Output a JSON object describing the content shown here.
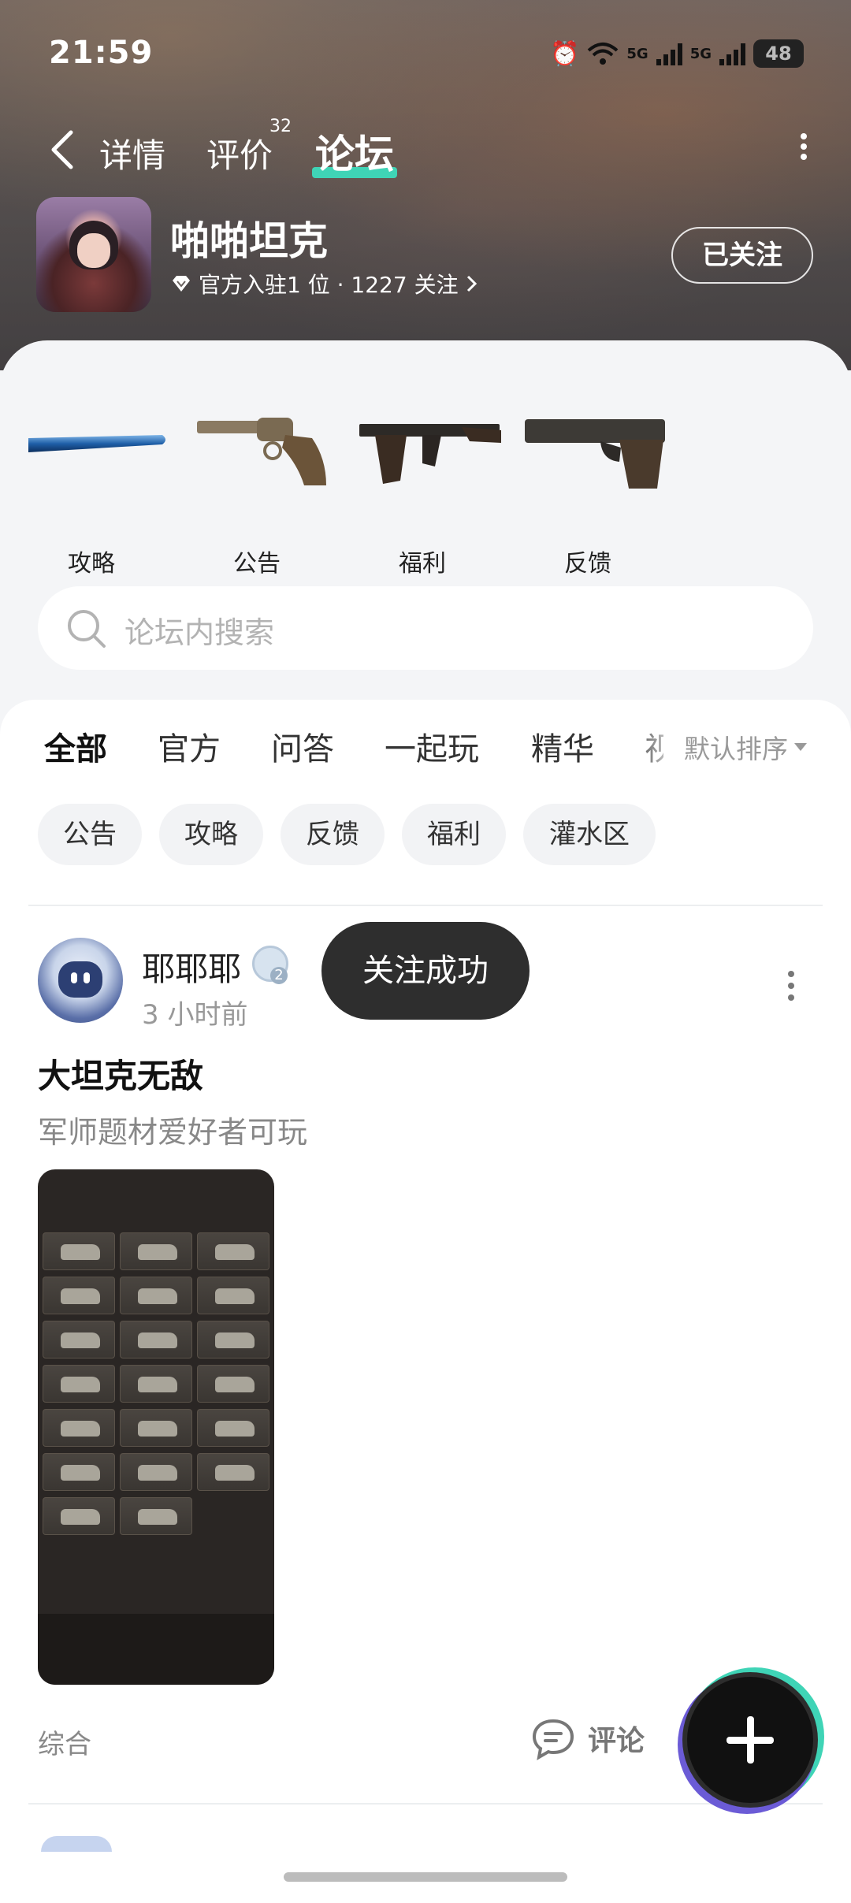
{
  "status_bar": {
    "time": "21:59",
    "network_1": "5G",
    "network_2": "5G",
    "battery": "48",
    "icons": [
      "alarm-icon",
      "wifi-icon",
      "signal-icon",
      "battery-icon"
    ]
  },
  "nav": {
    "tabs": [
      {
        "label": "详情",
        "active": false
      },
      {
        "label": "评价",
        "active": false,
        "badge": "32"
      },
      {
        "label": "论坛",
        "active": true
      }
    ]
  },
  "game": {
    "name": "啪啪坦克",
    "meta": "官方入驻1 位 · 1227 关注",
    "follow_label": "已关注"
  },
  "categories": [
    {
      "label": "攻略",
      "icon": "baseball-bat-icon"
    },
    {
      "label": "公告",
      "icon": "revolver-icon"
    },
    {
      "label": "福利",
      "icon": "rifle-icon"
    },
    {
      "label": "反馈",
      "icon": "pistol-icon"
    }
  ],
  "search": {
    "placeholder": "论坛内搜索"
  },
  "feed": {
    "tabs": [
      "全部",
      "官方",
      "问答",
      "一起玩",
      "精华",
      "视"
    ],
    "sort_label": "默认排序",
    "chips": [
      "公告",
      "攻略",
      "反馈",
      "福利",
      "灌水区"
    ]
  },
  "post": {
    "author": "耶耶耶",
    "level": "2",
    "time": "3 小时前",
    "title": "大坦克无敌",
    "body": "军师题材爱好者可玩",
    "footer_label": "综合",
    "comment_label": "评论"
  },
  "toast": "关注成功",
  "colors": {
    "accent": "#3fd4b6",
    "toast_bg": "#2e2e2e",
    "fab_bg": "#111111"
  }
}
